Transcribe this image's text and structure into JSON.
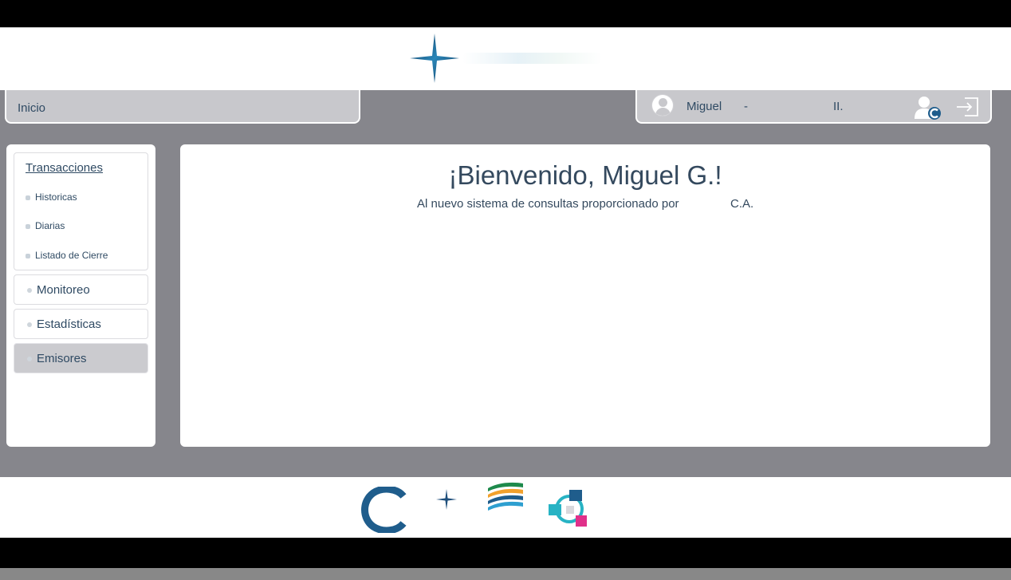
{
  "header": {
    "breadcrumb": "Inicio"
  },
  "user": {
    "name": "Miguel",
    "separator": "-",
    "suffix": "II."
  },
  "sidebar": {
    "group": {
      "title": "Transacciones",
      "items": [
        {
          "label": "Historicas"
        },
        {
          "label": "Diarias"
        },
        {
          "label": "Listado de Cierre"
        }
      ]
    },
    "items": [
      {
        "label": "Monitoreo"
      },
      {
        "label": "Estadísticas"
      },
      {
        "label": "Emisores",
        "active": true
      }
    ]
  },
  "main": {
    "welcome": "¡Bienvenido, Miguel G.!",
    "subtitle": "Al nuevo sistema de consultas proporcionado por",
    "subtitle_suffix": "C.A."
  },
  "icons": {
    "brand": "four-point-star-icon",
    "avatar": "user-avatar-icon",
    "switch_user": "user-change-icon",
    "logout": "logout-icon"
  },
  "colors": {
    "accent": "#1f5d8c",
    "text": "#34495e",
    "panel": "#86868c",
    "bar": "#c8c8cc"
  }
}
